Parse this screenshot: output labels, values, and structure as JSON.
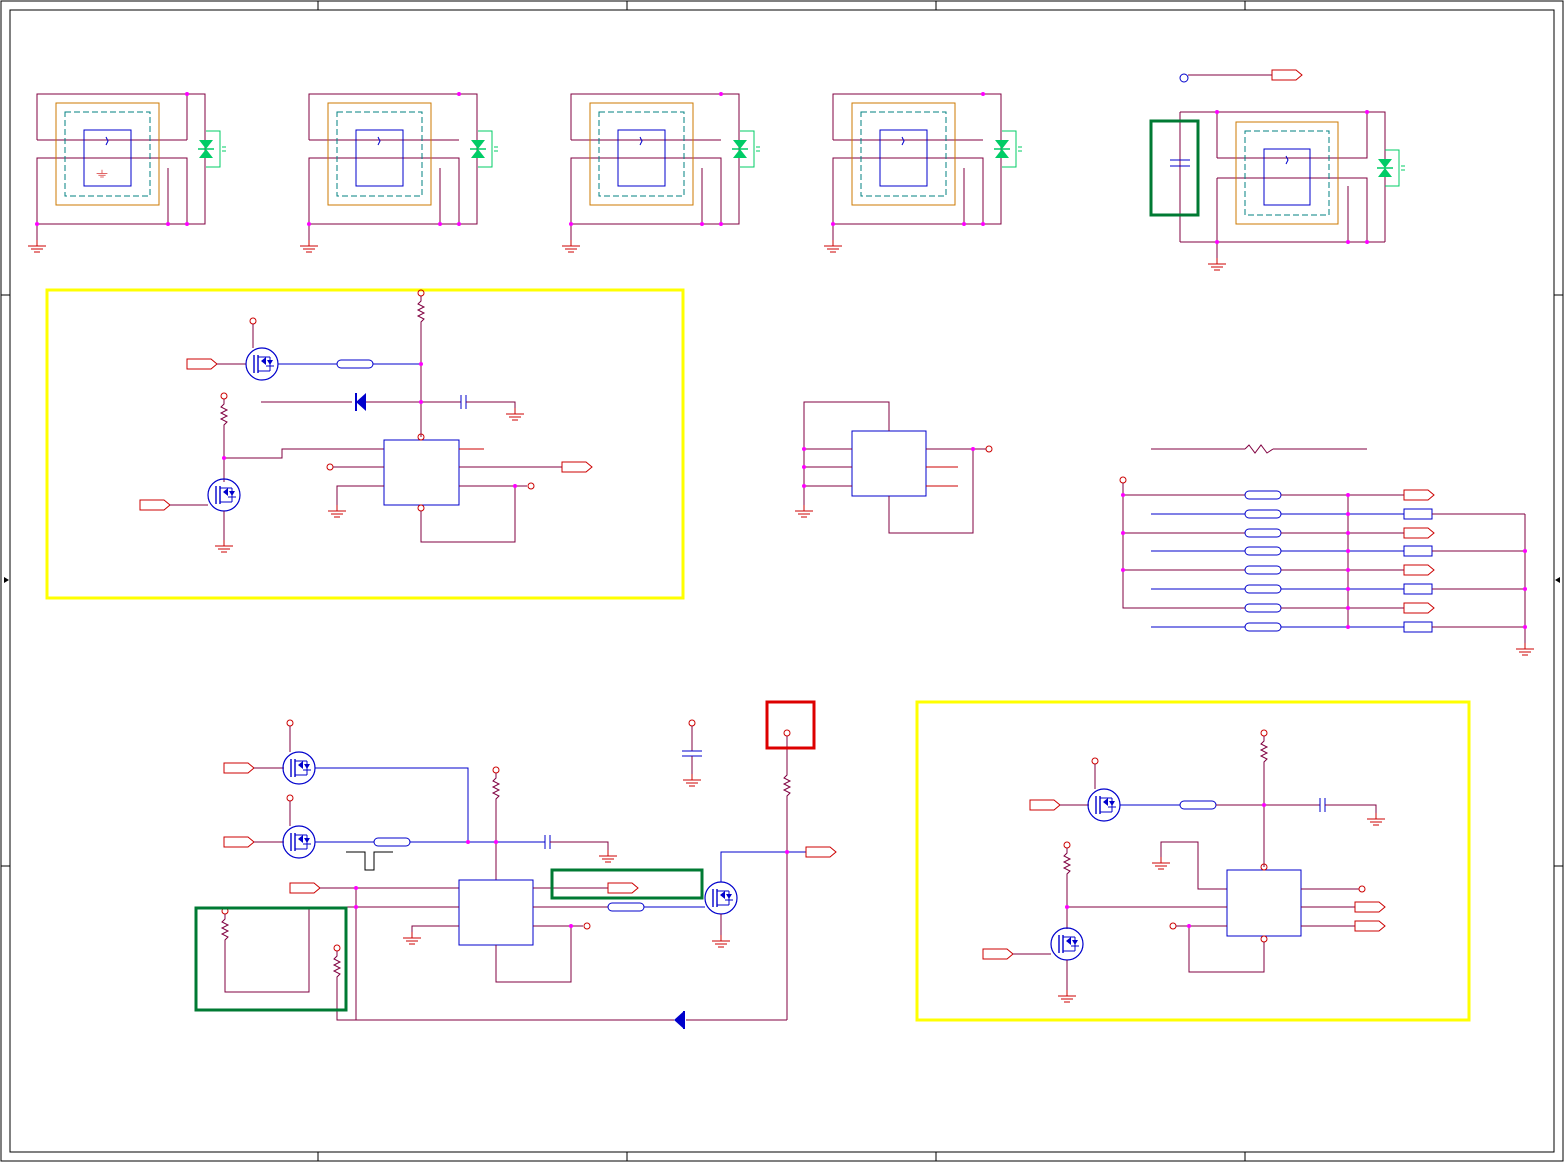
{
  "document": {
    "type": "electronic schematic sheet",
    "visible_text": []
  },
  "colors": {
    "border": "#000000",
    "wire_purple": "#800040",
    "wire_blue": "#000080",
    "pin_red": "#cc0000",
    "component_blue": "#0000cc",
    "junction_magenta": "#ff00ff",
    "tvs_green": "#00cc66",
    "guard_orange": "#cc7a00",
    "guard_teal": "#008080",
    "highlight_yellow": "#ffff00",
    "highlight_green": "#007a33",
    "highlight_red": "#dd0000"
  },
  "icons": {
    "ground": "ground-symbol",
    "mosfet": "mosfet-symbol",
    "resistor": "resistor-symbol",
    "capacitor": "capacitor-symbol",
    "diode": "diode-symbol",
    "tvs": "tvs-diode-symbol",
    "port": "port-flag-symbol",
    "ferrite": "ferrite-bead-symbol"
  },
  "sections": {
    "connector_blocks": 5,
    "highlight_regions": 6
  }
}
